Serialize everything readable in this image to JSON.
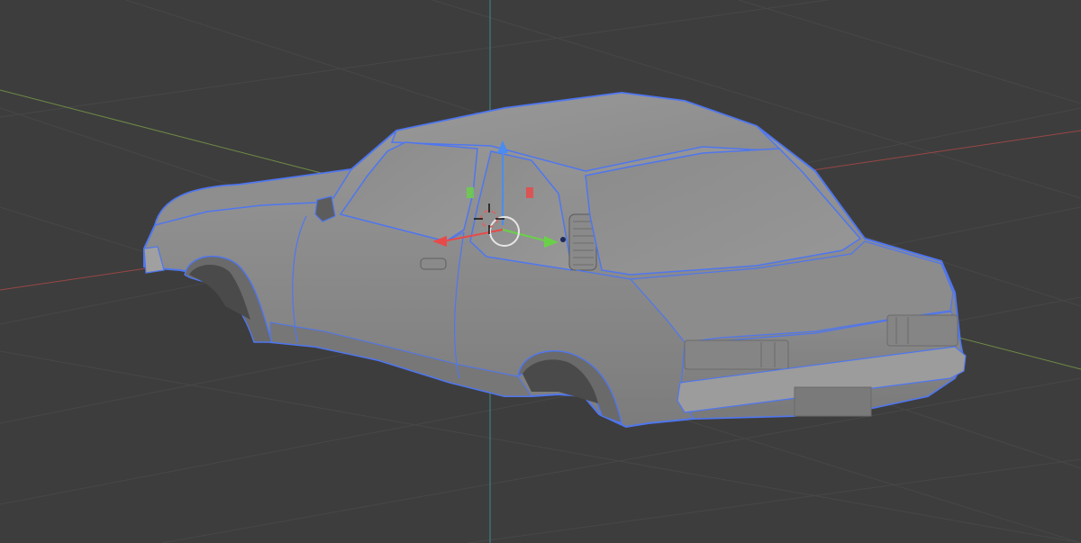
{
  "viewport": {
    "mode": "3d-viewport",
    "background_color": "#3d3d3d",
    "grid_color": "#4a4a4a",
    "selection_outline_color": "#4f76f0",
    "model_color": "#8f8f8f"
  },
  "axes": {
    "x_axis_color": "#b04a4a",
    "y_axis_color": "#7a9a4a",
    "z_axis_color": "#3f8f8f"
  },
  "gizmo": {
    "x_color": "#e84a4a",
    "y_color": "#6ad04a",
    "z_color": "#4a8cf0",
    "origin_icon": "3d-cursor-icon",
    "pivot_icon": "pivot-circle-icon"
  },
  "selected_object": {
    "icon": "car-body-mesh-icon",
    "selected": true
  }
}
